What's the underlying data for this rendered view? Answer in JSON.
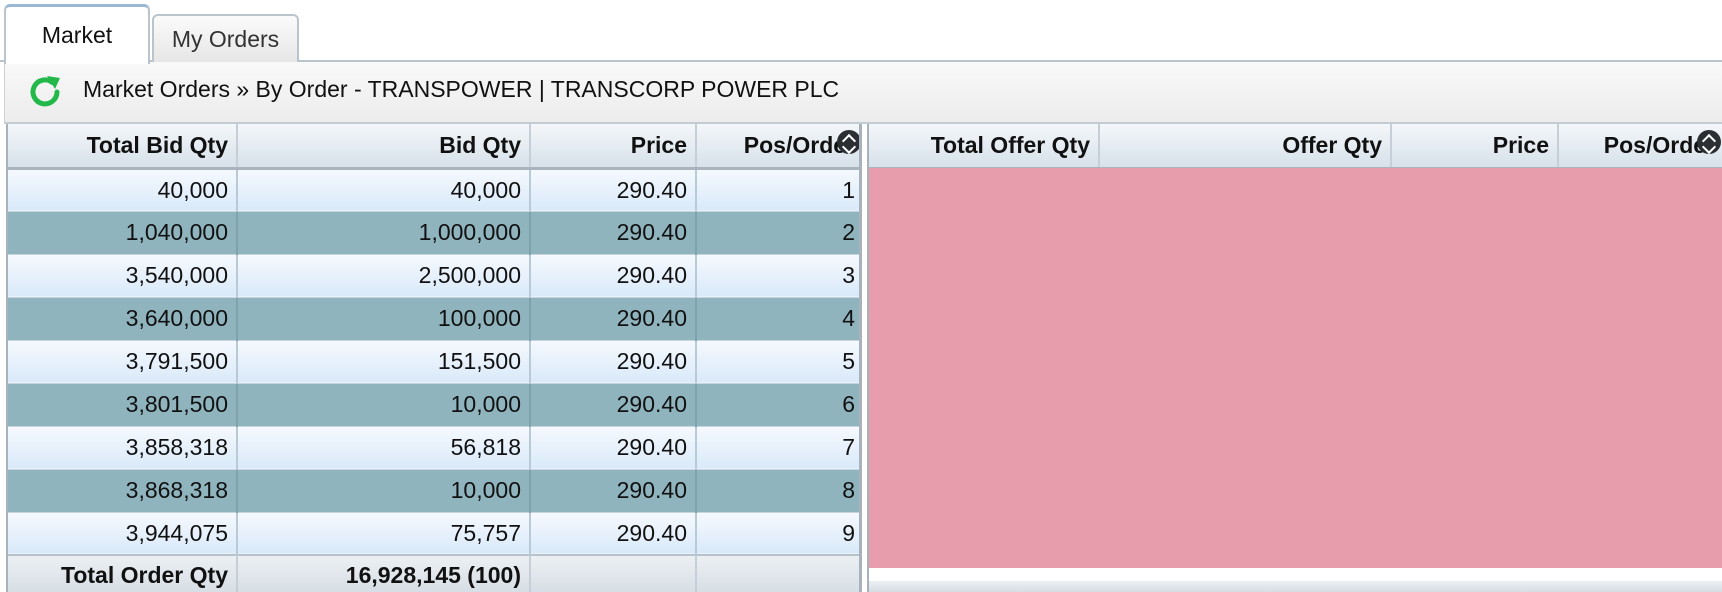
{
  "tabs": [
    {
      "label": "Market",
      "active": true
    },
    {
      "label": "My Orders",
      "active": false
    }
  ],
  "caption": {
    "icon": "refresh-icon",
    "text": "Market Orders » By Order - TRANSPOWER | TRANSCORP POWER PLC",
    "icon_color": "#22b84a"
  },
  "bid_grid": {
    "columns": [
      "Total Bid Qty",
      "Bid Qty",
      "Price",
      "Pos/Order"
    ],
    "rows": [
      [
        "40,000",
        "40,000",
        "290.40",
        "1"
      ],
      [
        "1,040,000",
        "1,000,000",
        "290.40",
        "2"
      ],
      [
        "3,540,000",
        "2,500,000",
        "290.40",
        "3"
      ],
      [
        "3,640,000",
        "100,000",
        "290.40",
        "4"
      ],
      [
        "3,791,500",
        "151,500",
        "290.40",
        "5"
      ],
      [
        "3,801,500",
        "10,000",
        "290.40",
        "6"
      ],
      [
        "3,858,318",
        "56,818",
        "290.40",
        "7"
      ],
      [
        "3,868,318",
        "10,000",
        "290.40",
        "8"
      ],
      [
        "3,944,075",
        "75,757",
        "290.40",
        "9"
      ]
    ],
    "footer": {
      "label": "Total Order Qty",
      "value": "16,928,145 (100)"
    }
  },
  "offer_grid": {
    "columns": [
      "Total Offer Qty",
      "Offer Qty",
      "Price",
      "Pos/Order"
    ],
    "rows": [],
    "empty_color": "#e89dad"
  },
  "colors": {
    "row_dark": "#90b4be",
    "row_light": "#dbeafa"
  }
}
